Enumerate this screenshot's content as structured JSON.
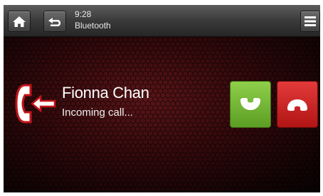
{
  "header": {
    "time": "9:28",
    "source": "Bluetooth",
    "home_icon": "home-icon",
    "back_icon": "back-icon",
    "menu_icon": "menu-icon"
  },
  "call": {
    "caller_name": "Fionna Chan",
    "status": "Incoming call...",
    "direction_icon": "incoming-call-icon",
    "accept_icon": "phone-accept-icon",
    "reject_icon": "phone-reject-icon"
  },
  "colors": {
    "accept": "#6fb232",
    "reject": "#d42121",
    "background": "#32090b"
  }
}
